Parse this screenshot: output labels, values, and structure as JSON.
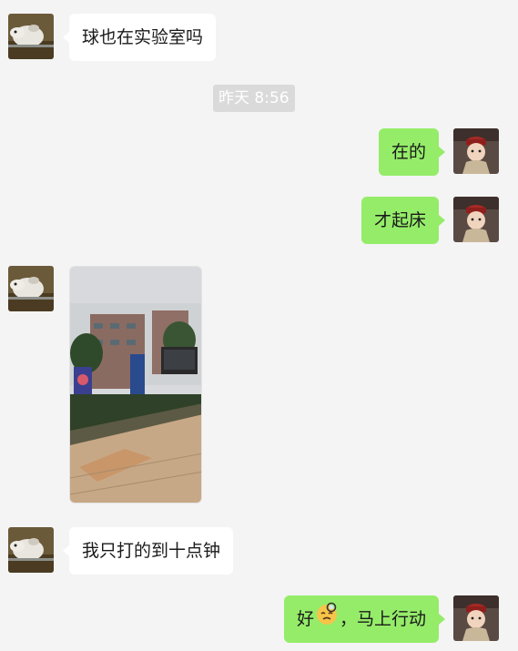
{
  "chat": {
    "timestamp": "昨天 8:56",
    "messages": [
      {
        "side": "left",
        "type": "text",
        "text": "球也在实验室吗"
      },
      {
        "side": "right",
        "type": "text",
        "text": "在的"
      },
      {
        "side": "right",
        "type": "text",
        "text": "才起床"
      },
      {
        "side": "left",
        "type": "image"
      },
      {
        "side": "left",
        "type": "text",
        "text": "我只打的到十点钟"
      },
      {
        "side": "right",
        "type": "text",
        "text_before": "好",
        "emoji": "sleepy-face-emoji",
        "text_after": "，马上行动"
      }
    ]
  },
  "colors": {
    "background": "#f4f4f4",
    "bubble_left": "#ffffff",
    "bubble_right": "#95ec69",
    "timestamp_bg": "#dadada"
  },
  "icons": {
    "left_avatar": "dog-avatar",
    "right_avatar": "child-avatar"
  }
}
